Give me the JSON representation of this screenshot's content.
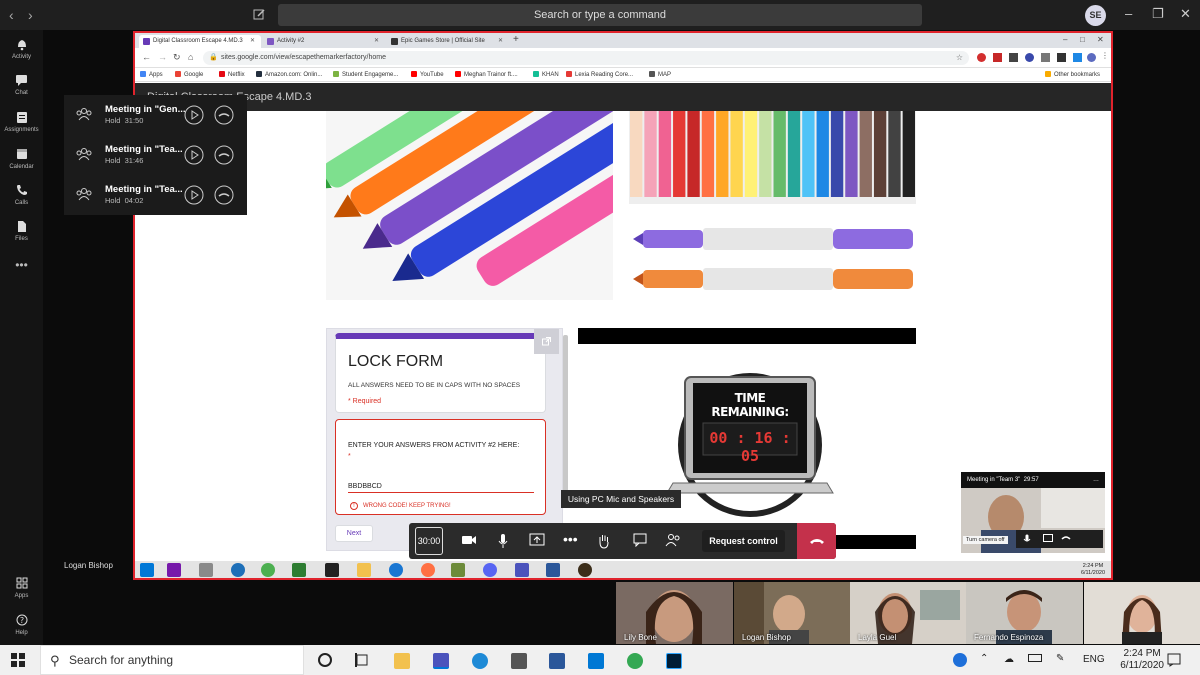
{
  "teams": {
    "search_placeholder": "Search or type a command",
    "user_initials": "SE",
    "rail": [
      {
        "label": "Activity",
        "icon": "bell-icon"
      },
      {
        "label": "Chat",
        "icon": "chat-icon"
      },
      {
        "label": "Assignments",
        "icon": "assignments-icon"
      },
      {
        "label": "Calendar",
        "icon": "calendar-icon"
      },
      {
        "label": "Calls",
        "icon": "phone-icon"
      },
      {
        "label": "Files",
        "icon": "file-icon"
      },
      {
        "label": "Apps",
        "icon": "apps-icon"
      },
      {
        "label": "Help",
        "icon": "help-icon"
      }
    ],
    "held_meetings": [
      {
        "title": "Meeting in \"Gen...",
        "status": "Hold",
        "time": "31:50"
      },
      {
        "title": "Meeting in \"Tea...",
        "status": "Hold",
        "time": "31:46"
      },
      {
        "title": "Meeting in \"Tea...",
        "status": "Hold",
        "time": "04:02"
      }
    ],
    "call_timer": "30:00",
    "request_control": "Request control",
    "tooltip": "Using PC Mic and Speakers",
    "presenter": "Logan Bishop",
    "self_view": {
      "title": "Meeting in \"Team 3\"",
      "time": "29:57",
      "turn_camera": "Turn camera off"
    },
    "gallery": [
      "Lily Bone",
      "Logan Bishop",
      "Layla Guel",
      "Fernando Espinoza",
      ""
    ]
  },
  "browser": {
    "tabs": [
      "Digital Classroom Escape 4.MD.3",
      "Activity #2",
      "Epic Games Store | Official Site"
    ],
    "url": "sites.google.com/view/escapethemarkerfactory/home",
    "bookmarks": [
      "Apps",
      "Google",
      "Netflix",
      "Amazon.com: Onlin...",
      "Student Engageme...",
      "YouTube",
      "Meghan Trainor ft....",
      "KHAN",
      "Lexia Reading Core...",
      "MAP"
    ],
    "other_bookmarks": "Other bookmarks"
  },
  "site": {
    "title": "Digital Classroom Escape 4.MD.3",
    "form": {
      "title": "LOCK FORM",
      "description": "ALL ANSWERS NEED TO BE IN CAPS WITH NO SPACES",
      "required": "* Required",
      "question": "ENTER YOUR ANSWERS FROM ACTIVITY #2 HERE:",
      "star": "*",
      "answer": "BBDBBCD",
      "error": "WRONG CODE! KEEP TRYING!",
      "next": "Next"
    },
    "timer": {
      "heading": "TIME REMAINING:",
      "display": "00 : 16 : 05"
    }
  },
  "inner_taskbar": {
    "time": "2:24 PM",
    "date": "6/11/2020"
  },
  "windows": {
    "search_placeholder": "Search for anything",
    "language": "ENG",
    "time": "2:24 PM",
    "date": "6/11/2020"
  }
}
